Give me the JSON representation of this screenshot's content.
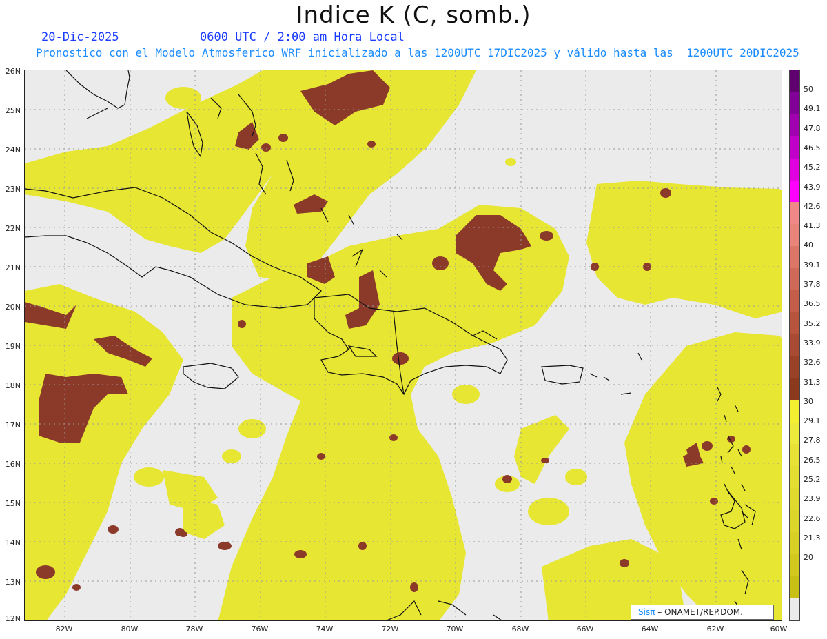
{
  "header": {
    "title": "Indice K (C, somb.)",
    "date": "20-Dic-2025",
    "time": "0600 UTC / 2:00 am Hora Local",
    "description": "Pronostico con el Modelo Atmosferico WRF inicializado a las 1200UTC_17DIC2025 y válido hasta las  1200UTC_20DIC2025"
  },
  "map": {
    "lon_range": [
      -83,
      -60
    ],
    "lat_range": [
      12,
      26
    ],
    "lat_labels": [
      "26N",
      "25N",
      "24N",
      "23N",
      "22N",
      "21N",
      "20N",
      "19N",
      "18N",
      "17N",
      "16N",
      "15N",
      "14N",
      "13N",
      "12N"
    ],
    "lon_labels": [
      "82W",
      "80W",
      "78W",
      "76W",
      "74W",
      "72W",
      "70W",
      "68W",
      "66W",
      "64W",
      "62W",
      "60W"
    ],
    "colors": {
      "background": "#ebebeb",
      "k_20_30": "#e6e633",
      "k_30_40": "#8b3a2a",
      "coastline": "#111111",
      "grid": "#9a9a9a"
    }
  },
  "colorbar": {
    "labels": [
      "50",
      "49.1",
      "47.8",
      "46.5",
      "45.2",
      "43.9",
      "42.6",
      "41.3",
      "40",
      "39.1",
      "37.8",
      "36.5",
      "35.2",
      "33.9",
      "32.6",
      "31.3",
      "30",
      "29.1",
      "27.8",
      "26.5",
      "25.2",
      "23.9",
      "22.6",
      "21.3",
      "20"
    ],
    "colors_bottom_to_top": [
      "#ebebeb",
      "#c8c014",
      "#d2c81e",
      "#d8d024",
      "#dcd62a",
      "#e0da2e",
      "#e4de32",
      "#e8e236",
      "#ecea3a",
      "#f2f030",
      "#8b3a1e",
      "#9a4228",
      "#a84a34",
      "#b6543e",
      "#c45e4a",
      "#d06a58",
      "#dc7666",
      "#e8847a",
      "#f08888",
      "#ff00ff",
      "#e000e0",
      "#c000c8",
      "#a000b0",
      "#800098",
      "#600070"
    ]
  },
  "credit": {
    "brand": "Sisπ",
    "org": " – ONAMET/REP.DOM."
  }
}
